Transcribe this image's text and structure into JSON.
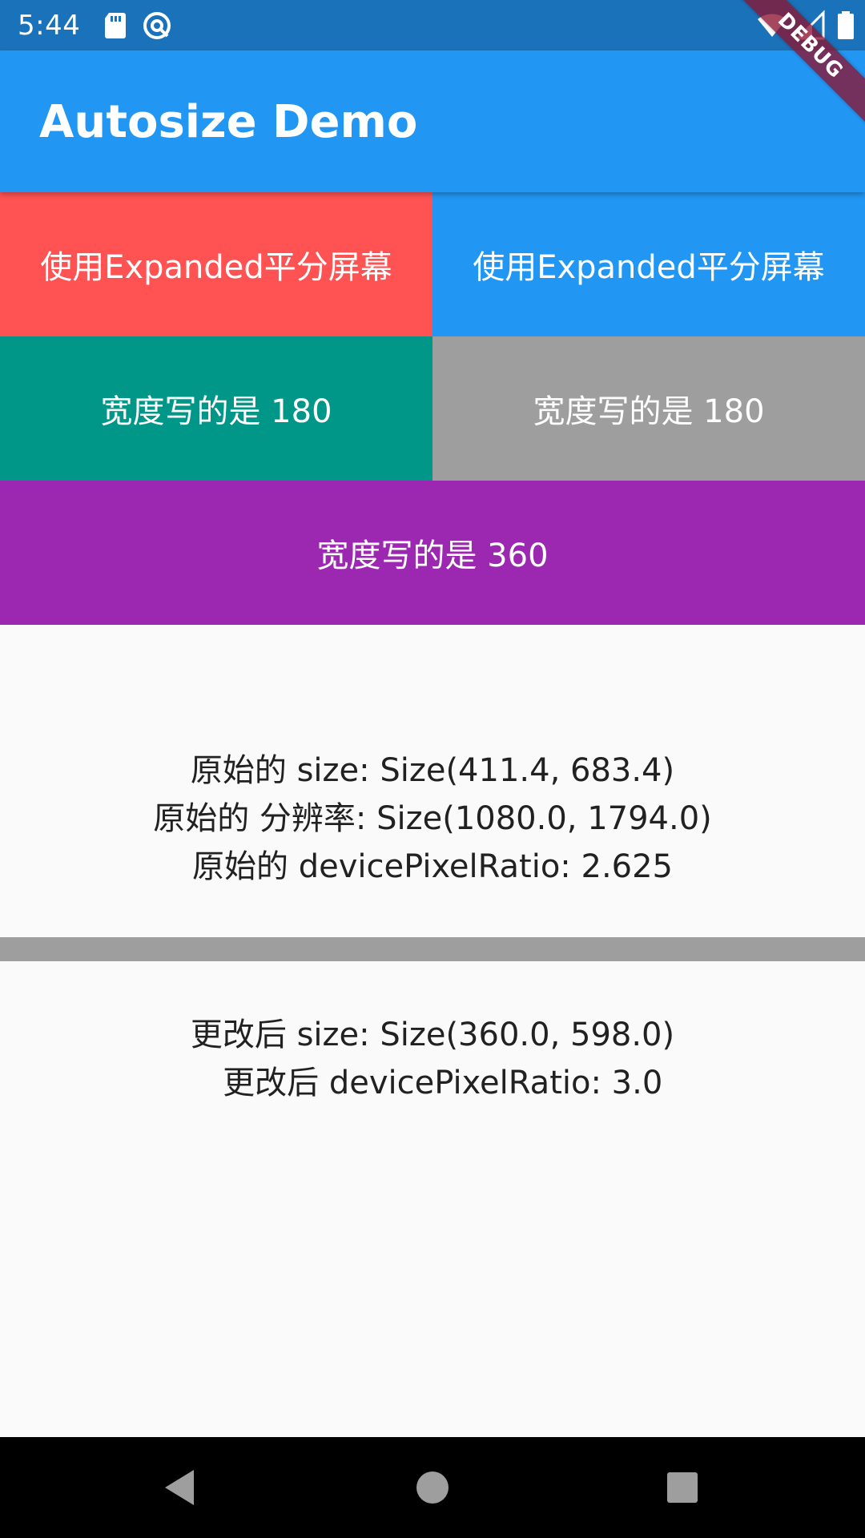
{
  "status_bar": {
    "time": "5:44",
    "icons": [
      "sd-card-icon",
      "sync-icon",
      "wifi-icon",
      "signal-icon",
      "battery-icon"
    ],
    "background": "#1a73ba"
  },
  "debug_banner": {
    "label": "DEBUG"
  },
  "app_bar": {
    "title": "Autosize Demo",
    "color": "#2196f3"
  },
  "blocks": {
    "expanded_left": {
      "label": "使用Expanded平分屏幕",
      "color": "#ff5252"
    },
    "expanded_right": {
      "label": "使用Expanded平分屏幕",
      "color": "#2196f3"
    },
    "width_180_left": {
      "label": "宽度写的是 180",
      "color": "#009688"
    },
    "width_180_right": {
      "label": "宽度写的是 180",
      "color": "#9e9e9e"
    },
    "width_360": {
      "label": "宽度写的是 360",
      "color": "#9c27b0"
    }
  },
  "original_info": {
    "size": "原始的 size: Size(411.4, 683.4)",
    "resolution": "原始的 分辨率: Size(1080.0, 1794.0)",
    "device_pixel_ratio": "原始的 devicePixelRatio: 2.625"
  },
  "changed_info": {
    "size": "更改后 size: Size(360.0, 598.0)",
    "device_pixel_ratio": "  更改后 devicePixelRatio: 3.0"
  },
  "nav_bar": {
    "buttons": [
      "back-icon",
      "home-icon",
      "recents-icon"
    ]
  }
}
